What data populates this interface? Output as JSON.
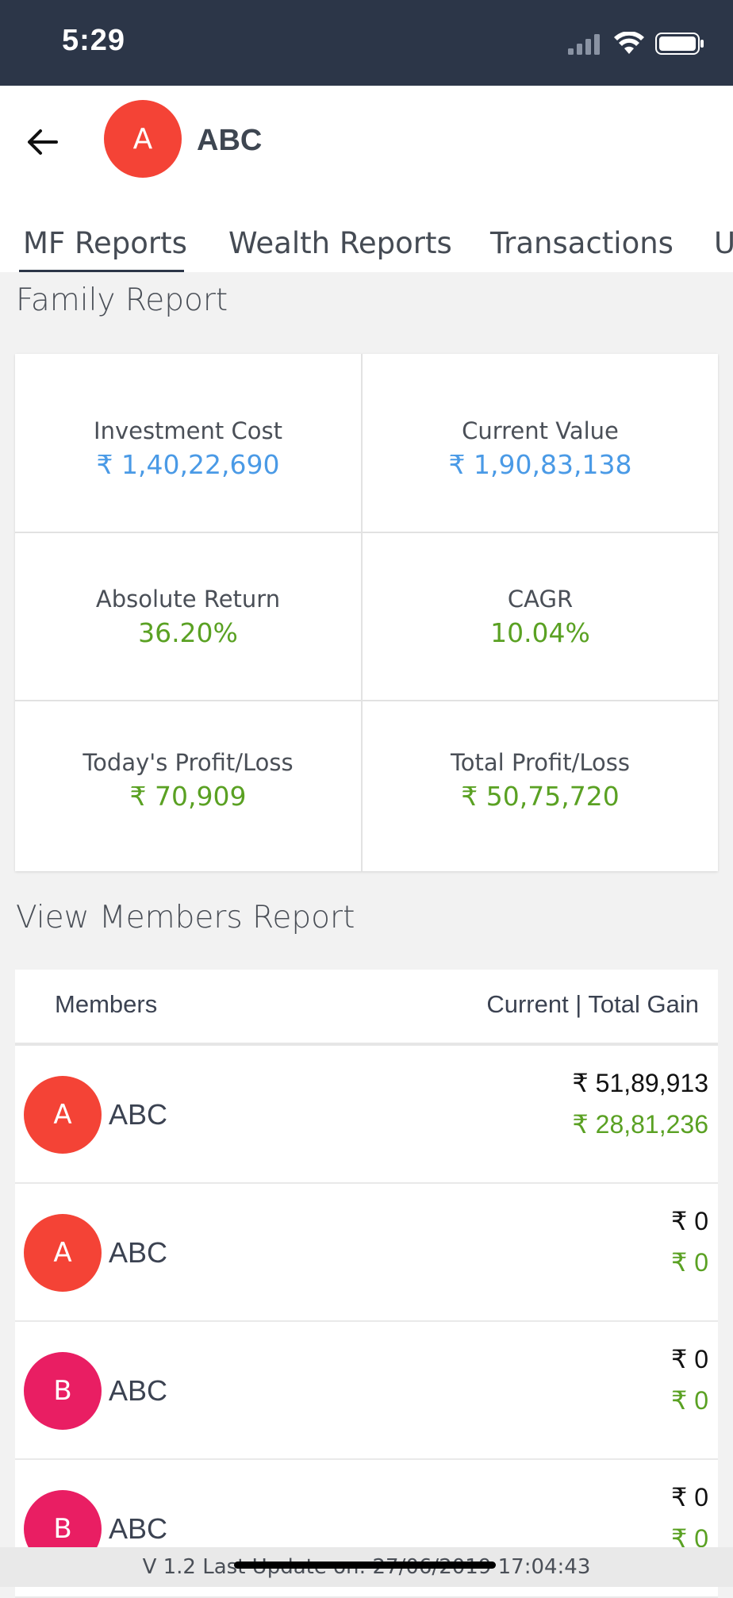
{
  "status_bar": {
    "time": "5:29",
    "icons": [
      "signal-icon",
      "wifi-icon",
      "battery-icon"
    ]
  },
  "header": {
    "back_icon": "back-arrow-icon",
    "avatar_letter": "A",
    "name": "ABC",
    "tabs": [
      "MF Reports",
      "Wealth Reports",
      "Transactions",
      "U"
    ],
    "active_tab": "MF Reports"
  },
  "family_report": {
    "title": "Family Report",
    "investment_cost": {
      "label": "Investment Cost",
      "value": "₹ 1,40,22,690"
    },
    "current_value": {
      "label": "Current Value",
      "value": "₹ 1,90,83,138"
    },
    "absolute_return": {
      "label": "Absolute Return",
      "value": "36.20%"
    },
    "cagr": {
      "label": "CAGR",
      "value": "10.04%"
    },
    "todays_profit_loss": {
      "label": "Today's Profit/Loss",
      "value": "₹ 70,909"
    },
    "total_profit_loss": {
      "label": "Total Profit/Loss",
      "value": "₹ 50,75,720"
    }
  },
  "members_report": {
    "title": "View Members Report",
    "col_members": "Members",
    "col_gain": "Current | Total Gain",
    "rows": [
      {
        "letter": "A",
        "name": "ABC",
        "current": "₹ 51,89,913",
        "gain": "₹ 28,81,236",
        "color": "#f44336"
      },
      {
        "letter": "A",
        "name": "ABC",
        "current": "₹ 0",
        "gain": "₹ 0",
        "color": "#f44336"
      },
      {
        "letter": "B",
        "name": "ABC",
        "current": "₹ 0",
        "gain": "₹ 0",
        "color": "#e91e63"
      },
      {
        "letter": "B",
        "name": "ABC",
        "current": "₹ 0",
        "gain": "₹ 0",
        "color": "#e91e63"
      }
    ]
  },
  "footer": {
    "text": "V  1.2   Last Update on: 27/06/2019 17:04:43"
  },
  "colors": {
    "status_bar": "#2c3648",
    "accent_blue": "#4a9ae6",
    "accent_green": "#5aa123",
    "avatar_red": "#f44336",
    "avatar_pink": "#e91e63"
  }
}
